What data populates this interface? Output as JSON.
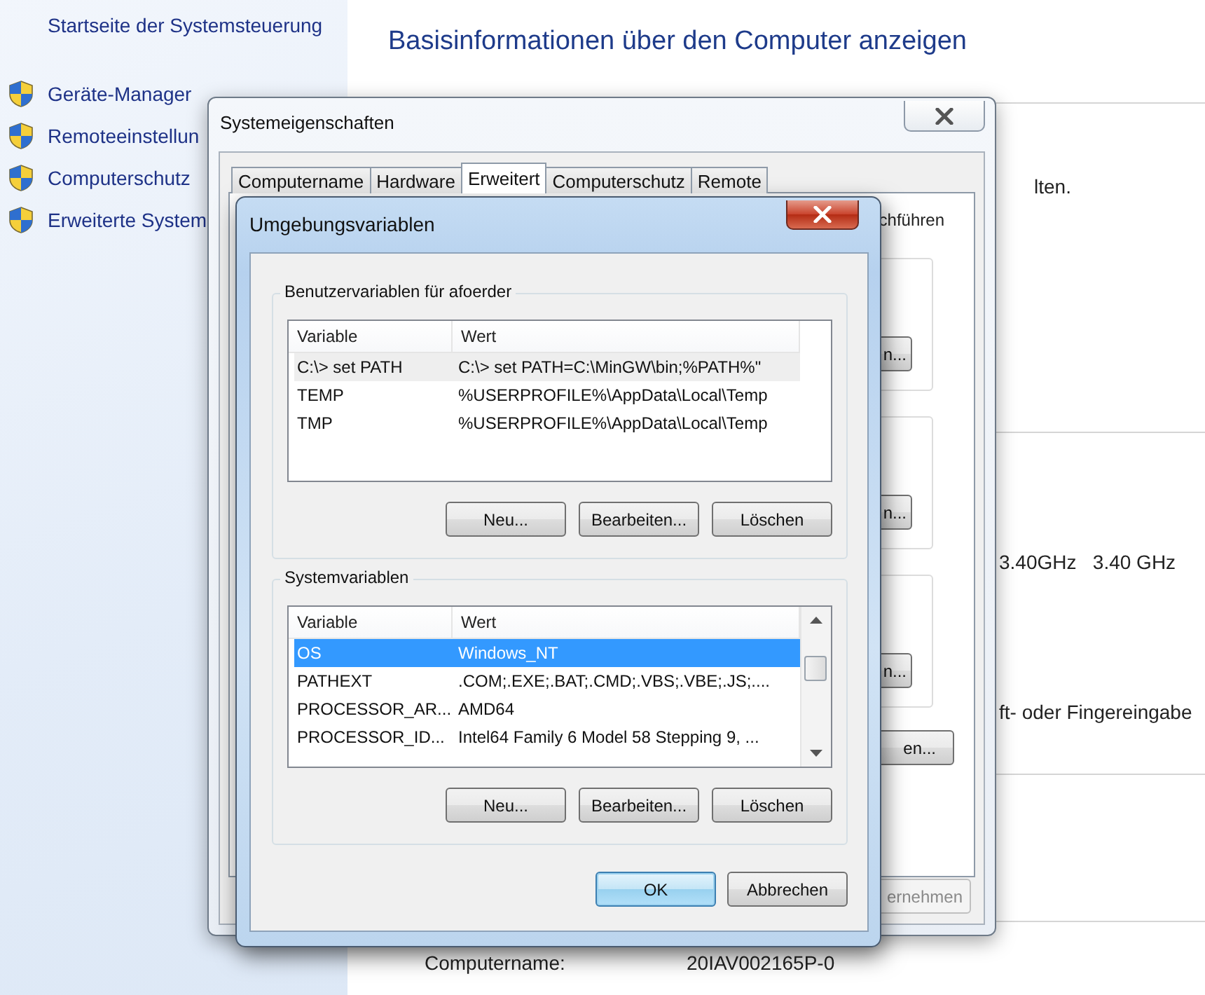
{
  "sidebar": {
    "home_link": "Startseite der Systemsteuerung",
    "items": [
      {
        "label": "Geräte-Manager"
      },
      {
        "label": "Remoteeinstellun"
      },
      {
        "label": "Computerschutz"
      },
      {
        "label": "Erweiterte System"
      }
    ]
  },
  "main": {
    "title": "Basisinformationen über den Computer anzeigen",
    "sections": [
      {
        "lines": [
          "lten."
        ]
      },
      {
        "lines": [
          "3.40GHz   3.40 GHz",
          "ft- oder Fingereingabe"
        ]
      }
    ],
    "computer_name": {
      "label": "Computername:",
      "value": "20IAV002165P-0"
    }
  },
  "system_properties": {
    "title": "Systemeigenschaften",
    "tabs": [
      {
        "label": "Computername",
        "selected": false
      },
      {
        "label": "Hardware",
        "selected": false
      },
      {
        "label": "Erweitert",
        "selected": true
      },
      {
        "label": "Computerschutz",
        "selected": false
      },
      {
        "label": "Remote",
        "selected": false
      }
    ],
    "panel_text": "chführen",
    "group_buttons": [
      "n...",
      "n...",
      "n..."
    ],
    "extra_button": "en...",
    "apply_button": {
      "label": "ernehmen",
      "disabled": true
    }
  },
  "environment_dialog": {
    "title": "Umgebungsvariablen",
    "groups": [
      {
        "title": "Benutzervariablen für afoerder",
        "columns": [
          "Variable",
          "Wert"
        ],
        "scrollbar": false,
        "rows": [
          {
            "variable": "C:\\> set PATH",
            "value": "C:\\> set PATH=C:\\MinGW\\bin;%PATH%\"",
            "selected": false,
            "hovered": true
          },
          {
            "variable": "TEMP",
            "value": "%USERPROFILE%\\AppData\\Local\\Temp",
            "selected": false,
            "hovered": false
          },
          {
            "variable": "TMP",
            "value": "%USERPROFILE%\\AppData\\Local\\Temp",
            "selected": false,
            "hovered": false
          }
        ],
        "buttons": [
          "Neu...",
          "Bearbeiten...",
          "Löschen"
        ]
      },
      {
        "title": "Systemvariablen",
        "columns": [
          "Variable",
          "Wert"
        ],
        "scrollbar": true,
        "rows": [
          {
            "variable": "OS",
            "value": "Windows_NT",
            "selected": true,
            "hovered": false
          },
          {
            "variable": "PATHEXT",
            "value": ".COM;.EXE;.BAT;.CMD;.VBS;.VBE;.JS;....",
            "selected": false,
            "hovered": false
          },
          {
            "variable": "PROCESSOR_AR...",
            "value": "AMD64",
            "selected": false,
            "hovered": false
          },
          {
            "variable": "PROCESSOR_ID...",
            "value": "Intel64 Family 6 Model 58 Stepping 9, ...",
            "selected": false,
            "hovered": false
          }
        ],
        "buttons": [
          "Neu...",
          "Bearbeiten...",
          "Löschen"
        ]
      }
    ],
    "buttons": [
      {
        "label": "OK",
        "default": true
      },
      {
        "label": "Abbrechen",
        "default": false
      }
    ]
  }
}
